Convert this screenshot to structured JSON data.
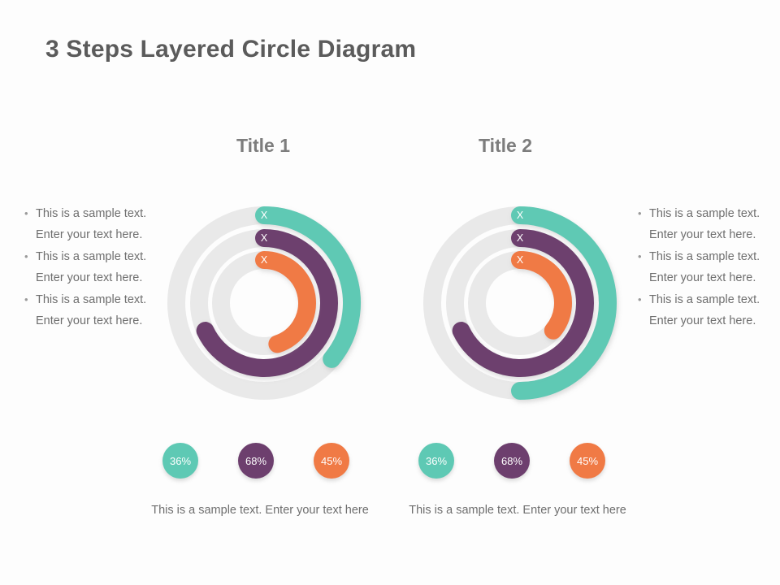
{
  "slide": {
    "title": "3 Steps Layered Circle Diagram",
    "background_color": "#fdfdfd",
    "title_color": "#5b5b5b"
  },
  "palette": {
    "teal": "#5ec9b4",
    "purple": "#6d3f6e",
    "orange": "#f07a45",
    "track": "#e9e9e9",
    "text": "#6e6e6e",
    "heading": "#7d7d7d"
  },
  "columns": [
    {
      "title": "Title 1",
      "bullets": [
        {
          "marker": "•",
          "text": "This is a sample text. Enter your text here."
        },
        {
          "marker": "•",
          "text": "This is a sample text. Enter your text here."
        },
        {
          "marker": "•",
          "text": "This is a sample text. Enter your text here."
        }
      ],
      "badges": [
        {
          "value": "36%",
          "color": "#5ec9b4"
        },
        {
          "value": "68%",
          "color": "#6d3f6e"
        },
        {
          "value": "45%",
          "color": "#f07a45"
        }
      ],
      "caption": "This is a sample text. Enter your text here"
    },
    {
      "title": "Title 2",
      "bullets": [
        {
          "marker": "•",
          "text": "This is a sample text. Enter your text here."
        },
        {
          "marker": "•",
          "text": "This is a sample text. Enter your text here."
        },
        {
          "marker": "•",
          "text": "This is a sample text. Enter your text here."
        }
      ],
      "badges": [
        {
          "value": "36%",
          "color": "#5ec9b4"
        },
        {
          "value": "68%",
          "color": "#6d3f6e"
        },
        {
          "value": "45%",
          "color": "#f07a45"
        }
      ],
      "caption": "This is a sample text. Enter your text here"
    }
  ],
  "chart_data": {
    "type": "pie",
    "title": "3 Steps Layered Circle Diagram",
    "note": "Two layered concentric donut (radial gauge) charts; each ring starts at 12 o'clock and sweeps clockwise over a light grey track. Each ring start cap is labelled X.",
    "charts": [
      {
        "name": "Title 1",
        "rings": [
          {
            "label": "X",
            "name": "outer",
            "color": "#5ec9b4",
            "value": 36,
            "radius": 108,
            "thickness": 22
          },
          {
            "label": "X",
            "name": "middle",
            "color": "#6d3f6e",
            "value": 68,
            "radius": 80,
            "thickness": 22
          },
          {
            "label": "X",
            "name": "inner",
            "color": "#f07a45",
            "value": 45,
            "radius": 53,
            "thickness": 22
          }
        ]
      },
      {
        "name": "Title 2",
        "rings": [
          {
            "label": "X",
            "name": "outer",
            "color": "#5ec9b4",
            "value": 50,
            "radius": 108,
            "thickness": 22
          },
          {
            "label": "X",
            "name": "middle",
            "color": "#6d3f6e",
            "value": 68,
            "radius": 80,
            "thickness": 22
          },
          {
            "label": "X",
            "name": "inner",
            "color": "#f07a45",
            "value": 36,
            "radius": 53,
            "thickness": 22
          }
        ]
      }
    ],
    "legend_values": [
      "36%",
      "68%",
      "45%"
    ],
    "legend_colors": [
      "#5ec9b4",
      "#6d3f6e",
      "#f07a45"
    ],
    "legend_position": "bottom"
  }
}
